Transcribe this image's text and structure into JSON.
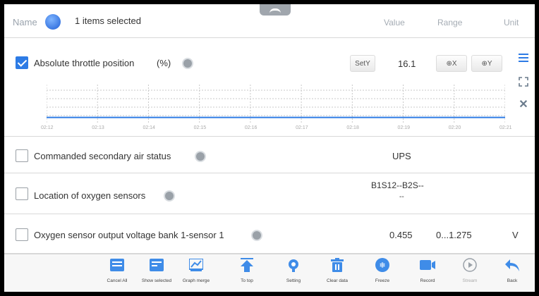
{
  "header": {
    "name_label": "Name",
    "selected_text": "1 items selected",
    "columns": [
      "Value",
      "Range",
      "Unit"
    ]
  },
  "params": [
    {
      "name": "Absolute throttle position",
      "unit_inline": "(%)",
      "value": "16.1",
      "checked": true,
      "sety_label": "SetY",
      "zoom_x_label": "⊕X",
      "zoom_y_label": "⊕Y"
    },
    {
      "name": "Commanded secondary air status",
      "value": "UPS",
      "checked": false
    },
    {
      "name": "Location of oxygen sensors",
      "value": "B1S12--B2S--",
      "value2": "--",
      "checked": false
    },
    {
      "name": "Oxygen sensor output voltage bank 1-sensor 1",
      "value": "0.455",
      "range": "0...1.275",
      "unit": "V",
      "checked": false
    }
  ],
  "chart_data": {
    "type": "line",
    "x_ticks": [
      "02:12",
      "02:13",
      "02:14",
      "02:15",
      "02:16",
      "02:17",
      "02:18",
      "02:19",
      "02:20",
      "02:21"
    ],
    "series": [
      {
        "values": [
          16.1,
          16.1,
          16.1,
          16.1,
          16.1,
          16.1,
          16.1,
          16.1,
          16.1,
          16.1
        ]
      }
    ],
    "grid": true
  },
  "footer": {
    "buttons": [
      {
        "label": "Cancel All",
        "icon": "cancel-all-icon"
      },
      {
        "label": "Show selected",
        "icon": "show-selected-icon"
      },
      {
        "label": "Graph merge",
        "icon": "graph-merge-icon"
      },
      {
        "label": "To top",
        "icon": "to-top-icon"
      },
      {
        "label": "Setting",
        "icon": "setting-icon"
      },
      {
        "label": "Clear data",
        "icon": "clear-data-icon"
      },
      {
        "label": "Freeze",
        "icon": "freeze-icon"
      },
      {
        "label": "Record",
        "icon": "record-icon"
      },
      {
        "label": "Stream",
        "icon": "stream-icon"
      },
      {
        "label": "Back",
        "icon": "back-icon"
      }
    ]
  },
  "colors": {
    "accent": "#2d7be5",
    "line": "#2d7be5",
    "grid": "#c8c8c8"
  }
}
